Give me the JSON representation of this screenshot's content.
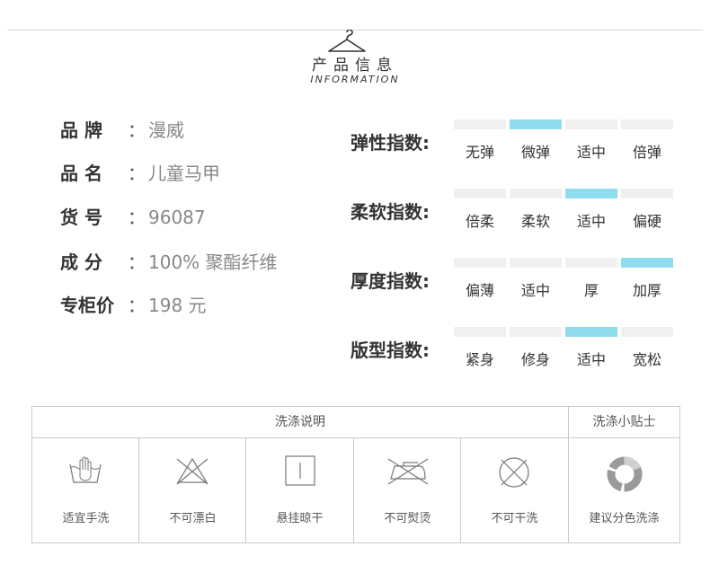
{
  "header": {
    "title_cn": "产品信息",
    "title_en": "INFORMATION",
    "hanger_icon": "hanger-icon"
  },
  "product_info": [
    {
      "label": "品  牌",
      "colon": "：",
      "value": "漫威"
    },
    {
      "label": "品  名",
      "colon": "：",
      "value": "儿童马甲"
    },
    {
      "label": "货  号",
      "colon": "：",
      "value": "96087"
    },
    {
      "label": "成  分",
      "colon": "：",
      "value": "100% 聚酯纤维"
    },
    {
      "label": "专柜价",
      "colon": "：",
      "value": "198 元"
    }
  ],
  "indices": [
    {
      "label": "弹性指数:",
      "options": [
        "无弹",
        "微弹",
        "适中",
        "倍弹"
      ],
      "selected_index": 1
    },
    {
      "label": "柔软指数:",
      "options": [
        "倍柔",
        "柔软",
        "适中",
        "偏硬"
      ],
      "selected_index": 2
    },
    {
      "label": "厚度指数:",
      "options": [
        "偏薄",
        "适中",
        "厚",
        "加厚"
      ],
      "selected_index": 3
    },
    {
      "label": "版型指数:",
      "options": [
        "紧身",
        "修身",
        "适中",
        "宽松"
      ],
      "selected_index": 2
    }
  ],
  "colors": {
    "accent": "#8fdcef",
    "bar_inactive": "#f0f0f0",
    "border": "#c9c9c9"
  },
  "washing": {
    "header": "洗涤说明",
    "tips_header": "洗涤小贴士",
    "items": [
      {
        "icon": "hand-wash-icon",
        "label": "适宜手洗"
      },
      {
        "icon": "no-bleach-icon",
        "label": "不可漂白"
      },
      {
        "icon": "hang-dry-icon",
        "label": "悬挂晾干"
      },
      {
        "icon": "no-iron-icon",
        "label": "不可熨烫"
      },
      {
        "icon": "no-dry-clean-icon",
        "label": "不可干洗"
      }
    ],
    "tip": {
      "icon": "color-separate-icon",
      "label": "建议分色洗涤"
    }
  }
}
